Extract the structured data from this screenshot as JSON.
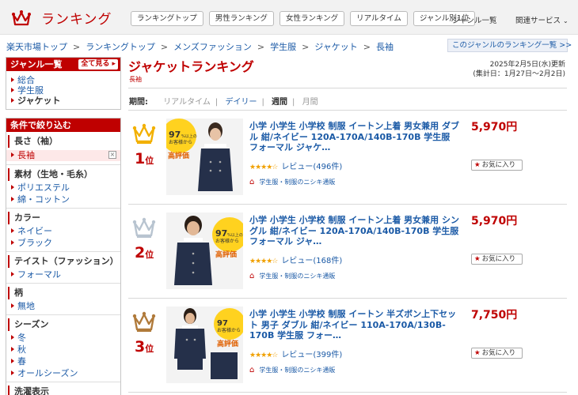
{
  "header": {
    "logo_text": "ランキング",
    "tabs": [
      "ランキングトップ",
      "男性ランキング",
      "女性ランキング",
      "リアルタイム",
      "ジャンル別1位"
    ],
    "genre_list": "ジャンル一覧",
    "related": "関連サービス"
  },
  "breadcrumb": [
    "楽天市場トップ",
    "ランキングトップ",
    "メンズファッション",
    "学生服",
    "ジャケット",
    "長袖"
  ],
  "genre_list_button": "このジャンルのランキング一覧 >>",
  "sidebar": {
    "genre_title": "ジャンル一覧",
    "see_all": "全て見る",
    "genres": [
      "総合",
      "学生服",
      "ジャケット"
    ],
    "filter_title": "条件で絞り込む",
    "filters": [
      {
        "name": "長さ（袖）",
        "selected": "長袖"
      },
      {
        "name": "素材（生地・毛糸）",
        "options": [
          "ポリエステル",
          "綿・コットン"
        ]
      },
      {
        "name": "カラー",
        "options": [
          "ネイビー",
          "ブラック"
        ]
      },
      {
        "name": "テイスト（ファッション）",
        "options": [
          "フォーマル"
        ]
      },
      {
        "name": "柄",
        "options": [
          "無地"
        ]
      },
      {
        "name": "シーズン",
        "options": [
          "冬",
          "秋",
          "春",
          "オールシーズン"
        ]
      },
      {
        "name": "洗濯表示"
      }
    ]
  },
  "main": {
    "title": "ジャケットランキング",
    "subtitle": "長袖",
    "updated": "2025年2月5日(水)更新",
    "period_range": "(集計日：1月27日〜2月2日)",
    "period_label": "期間:",
    "periods": [
      "リアルタイム",
      "デイリー",
      "週間",
      "月間"
    ],
    "fav_label": "お気に入り"
  },
  "items": [
    {
      "rank": "1",
      "rank_suffix": "位",
      "name": "小学 小学生 小学校 制服 イートン上着 男女兼用 ダブル 紺/ネイビー 120A-170A/140B-170B 学生服 フォーマル ジャケ…",
      "stars": "★★★★☆",
      "reviews": "レビュー(496件)",
      "shop": "学生服・制服のニシキ通販",
      "price": "5,970円",
      "crown_color": "#f2b000"
    },
    {
      "rank": "2",
      "rank_suffix": "位",
      "name": "小学 小学生 小学校 制服 イートン上着 男女兼用 シングル 紺/ネイビー 120A-170A/140B-170B 学生服 フォーマル ジャ…",
      "stars": "★★★★☆",
      "reviews": "レビュー(168件)",
      "shop": "学生服・制服のニシキ通販",
      "price": "5,970円",
      "crown_color": "#b8c4d0"
    },
    {
      "rank": "3",
      "rank_suffix": "位",
      "name": "小学 小学生 小学校 制服 イートン 半ズボン上下セット 男子 ダブル 紺/ネイビー 110A-170A/130B-170B 学生服 フォー…",
      "stars": "★★★★☆",
      "reviews": "レビュー(399件)",
      "shop": "学生服・制服のニシキ通販",
      "price": "7,750円",
      "crown_color": "#b07a3a"
    }
  ],
  "thumb_badge": {
    "percent": "97",
    "unit": "%以上の",
    "line2": "お客様から",
    "line3": "高評価"
  }
}
